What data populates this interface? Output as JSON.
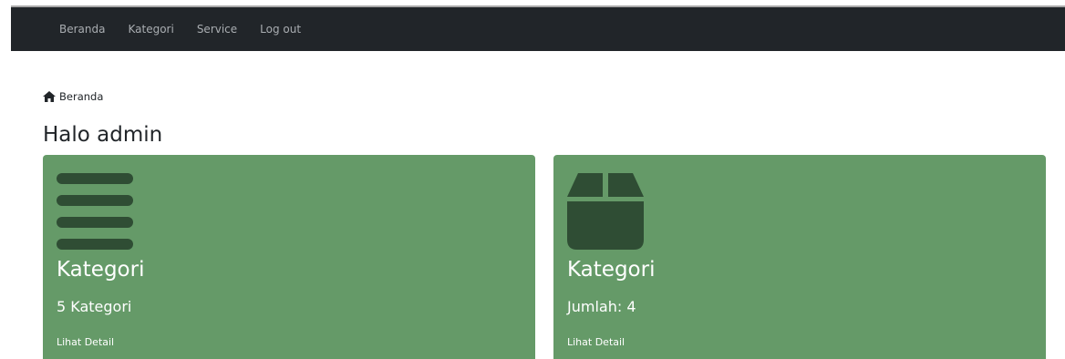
{
  "nav": {
    "items": [
      {
        "label": "Beranda"
      },
      {
        "label": "Kategori"
      },
      {
        "label": "Service"
      },
      {
        "label": "Log out"
      }
    ]
  },
  "breadcrumb": {
    "label": "Beranda",
    "icon": "home-icon"
  },
  "main": {
    "title": "Halo admin"
  },
  "cards": [
    {
      "icon": "bars-icon",
      "title": "Kategori",
      "value": "5 Kategori",
      "link": "Lihat Detail"
    },
    {
      "icon": "box-icon",
      "title": "Kategori",
      "value": "Jumlah: 4",
      "link": "Lihat Detail"
    }
  ],
  "colors": {
    "topbar": "#212529",
    "card": "#659a68",
    "icon": "#2f4d34"
  }
}
